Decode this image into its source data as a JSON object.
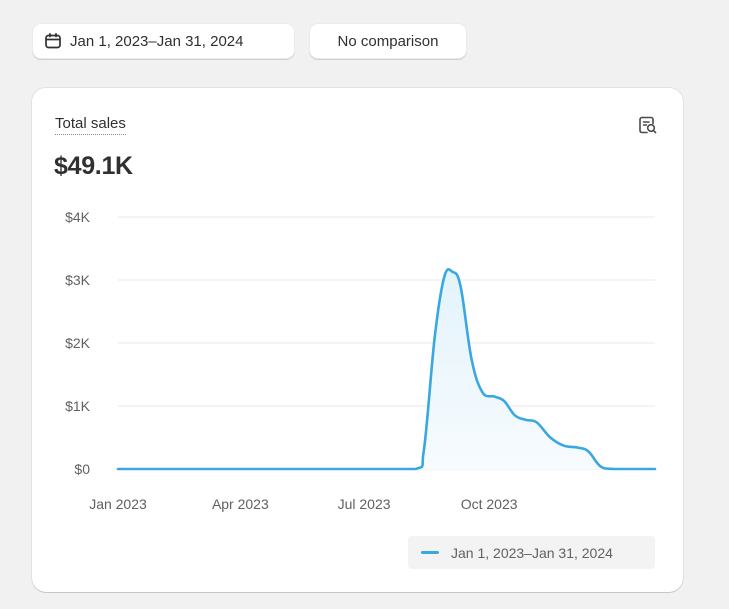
{
  "toolbar": {
    "date_range_label": "Jan 1, 2023–Jan 31, 2024",
    "comparison_label": "No comparison",
    "date_icon": "calendar-icon"
  },
  "card": {
    "metric_title": "Total sales",
    "metric_value": "$49.1K",
    "report_icon": "report-search-icon"
  },
  "colors": {
    "series": "#3aa8e0",
    "area_fill": "#eaf6fc",
    "grid": "#e8e8e8",
    "background": "#f1f1f1"
  },
  "chart_data": {
    "type": "area",
    "x_tick_labels": [
      "Jan 2023",
      "Apr 2023",
      "Jul 2023",
      "Oct 2023"
    ],
    "x_ticks_at": [
      "2023-01-01",
      "2023-04-01",
      "2023-07-01",
      "2023-10-01"
    ],
    "y_tick_labels": [
      "$0",
      "$1K",
      "$2K",
      "$3K",
      "$4K"
    ],
    "y_ticks": [
      0,
      1000,
      2000,
      3000,
      4000
    ],
    "ylim": [
      0,
      4000
    ],
    "xlim": [
      "2023-01-01",
      "2024-01-31"
    ],
    "grid": true,
    "legend_position": "bottom-right",
    "series": [
      {
        "name": "Jan 1, 2023–Jan 31, 2024",
        "points": [
          [
            "2023-01-01",
            0
          ],
          [
            "2023-04-01",
            0
          ],
          [
            "2023-07-01",
            0
          ],
          [
            "2023-08-08",
            0
          ],
          [
            "2023-08-14",
            300
          ],
          [
            "2023-08-22",
            2100
          ],
          [
            "2023-08-29",
            3050
          ],
          [
            "2023-09-04",
            3130
          ],
          [
            "2023-09-10",
            2900
          ],
          [
            "2023-09-18",
            1750
          ],
          [
            "2023-09-26",
            1220
          ],
          [
            "2023-10-05",
            1150
          ],
          [
            "2023-10-12",
            1080
          ],
          [
            "2023-10-20",
            850
          ],
          [
            "2023-10-28",
            780
          ],
          [
            "2023-11-05",
            740
          ],
          [
            "2023-11-15",
            500
          ],
          [
            "2023-11-25",
            370
          ],
          [
            "2023-12-05",
            340
          ],
          [
            "2023-12-13",
            280
          ],
          [
            "2023-12-22",
            40
          ],
          [
            "2024-01-01",
            0
          ],
          [
            "2024-01-31",
            0
          ]
        ]
      }
    ]
  }
}
